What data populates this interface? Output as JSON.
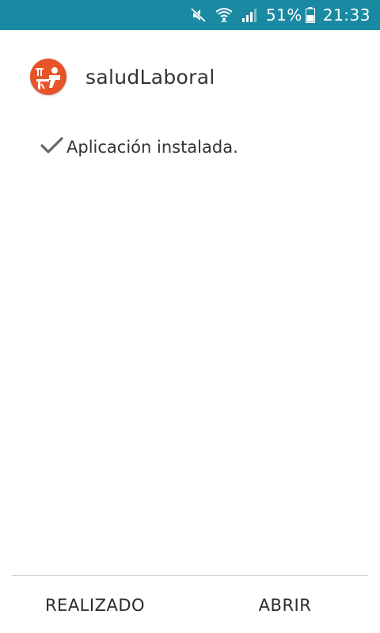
{
  "status_bar": {
    "battery_percent": "51%",
    "time": "21:33",
    "icons": [
      "mute-icon",
      "wifi-icon",
      "signal-icon",
      "battery-icon"
    ],
    "background_color": "#1a8aa3"
  },
  "app": {
    "name": "saludLaboral",
    "icon": "app-icon",
    "icon_color": "#e8542a"
  },
  "install": {
    "icon": "checkmark-icon",
    "message": "Aplicación instalada."
  },
  "footer": {
    "done_label": "REALIZADO",
    "open_label": "ABRIR"
  }
}
